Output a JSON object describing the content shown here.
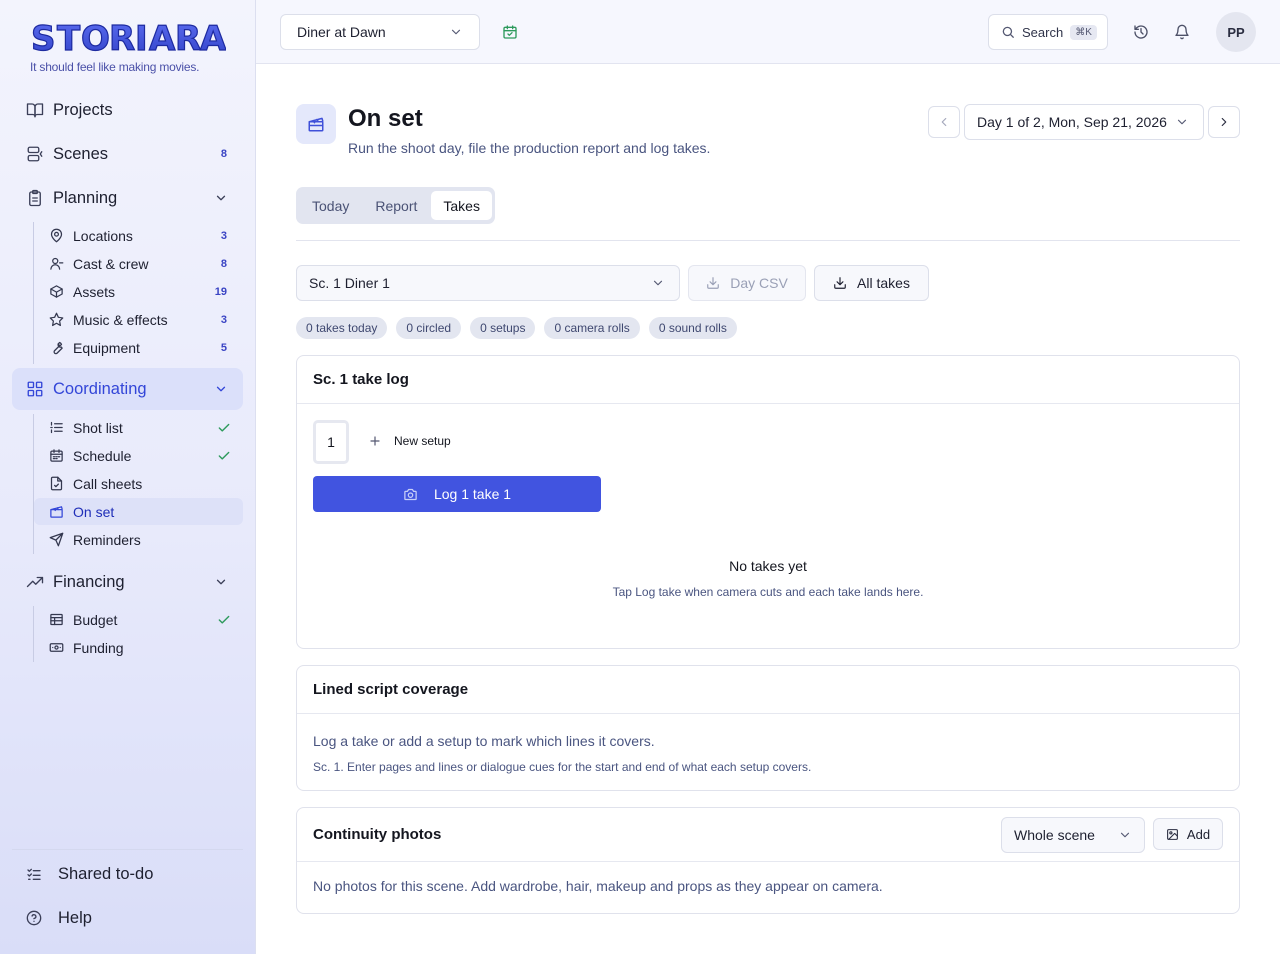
{
  "brand": {
    "logo_text": "STORIARA",
    "tagline": "It should feel like making movies."
  },
  "sidebar": {
    "projects": {
      "label": "Projects",
      "icon": "book-open-icon"
    },
    "scenes": {
      "label": "Scenes",
      "count": "8",
      "icon": "scenes-icon"
    },
    "planning": {
      "label": "Planning",
      "icon": "clipboard-icon",
      "items": [
        {
          "label": "Locations",
          "count": "3",
          "icon": "map-pin-icon"
        },
        {
          "label": "Cast & crew",
          "count": "8",
          "icon": "user-icon"
        },
        {
          "label": "Assets",
          "count": "19",
          "icon": "box-icon"
        },
        {
          "label": "Music & effects",
          "count": "3",
          "icon": "star-icon"
        },
        {
          "label": "Equipment",
          "count": "5",
          "icon": "wrench-icon"
        }
      ]
    },
    "coordinating": {
      "label": "Coordinating",
      "icon": "grid-icon",
      "items": [
        {
          "label": "Shot list",
          "done": true,
          "icon": "list-icon"
        },
        {
          "label": "Schedule",
          "done": true,
          "icon": "calendar-icon"
        },
        {
          "label": "Call sheets",
          "done": false,
          "icon": "file-check-icon"
        },
        {
          "label": "On set",
          "done": false,
          "active": true,
          "icon": "clapperboard-icon"
        },
        {
          "label": "Reminders",
          "done": false,
          "icon": "send-icon"
        }
      ]
    },
    "financing": {
      "label": "Financing",
      "icon": "trending-up-icon",
      "items": [
        {
          "label": "Budget",
          "done": true,
          "icon": "table-icon"
        },
        {
          "label": "Funding",
          "done": false,
          "icon": "banknote-icon"
        }
      ]
    },
    "shared_todo": {
      "label": "Shared to-do",
      "icon": "checklist-icon"
    },
    "help": {
      "label": "Help",
      "icon": "help-circle-icon"
    }
  },
  "topbar": {
    "project": "Diner at Dawn",
    "search_label": "Search",
    "search_shortcut": "⌘K",
    "avatar_initials": "PP"
  },
  "page": {
    "title": "On set",
    "subtitle": "Run the shoot day, file the production report and log takes.",
    "day_label": "Day 1 of 2, Mon, Sep 21, 2026",
    "tabs": [
      "Today",
      "Report",
      "Takes"
    ],
    "active_tab": "Takes"
  },
  "takes": {
    "scene_select": "Sc. 1 Diner 1",
    "day_csv_label": "Day CSV",
    "all_takes_label": "All takes",
    "chips": [
      "0 takes today",
      "0 circled",
      "0 setups",
      "0 camera rolls",
      "0 sound rolls"
    ],
    "take_log": {
      "title": "Sc. 1 take log",
      "setup_number": "1",
      "new_setup_label": "New setup",
      "log_button": "Log 1 take 1",
      "empty_title": "No takes yet",
      "empty_sub": "Tap Log take when camera cuts and each take lands here."
    },
    "coverage": {
      "title": "Lined script coverage",
      "line1": "Log a take or add a setup to mark which lines it covers.",
      "line2": "Sc. 1. Enter pages and lines or dialogue cues for the start and end of what each setup covers."
    },
    "photos": {
      "title": "Continuity photos",
      "filter": "Whole scene",
      "add_label": "Add",
      "empty": "No photos for this scene. Add wardrobe, hair, makeup and props as they appear on camera."
    }
  },
  "colors": {
    "accent": "#4154e0",
    "check": "#2d9a5c",
    "count": "#3a44c4"
  }
}
